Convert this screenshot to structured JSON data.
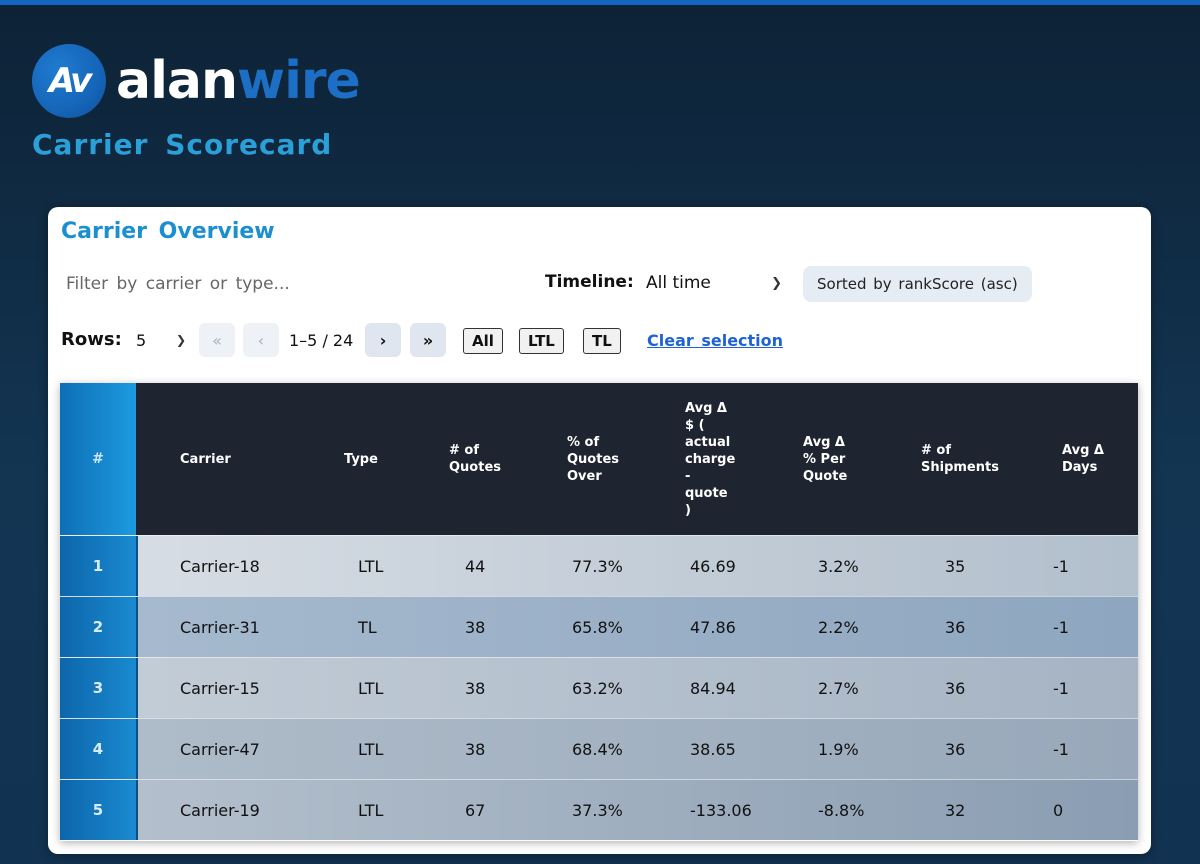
{
  "brand": {
    "logo_letters": "Av",
    "name_part1": "alan",
    "name_part2": "wire",
    "subtitle": "Carrier Scorecard"
  },
  "card": {
    "title": "Carrier Overview",
    "filter_placeholder": "Filter by carrier or type...",
    "timeline_label": "Timeline:",
    "timeline_value": "All time",
    "sort_badge": "Sorted by rankScore (asc)",
    "rows_label": "Rows:",
    "rows_value": "5",
    "pager": {
      "first": "«",
      "prev": "‹",
      "info": "1–5 / 24",
      "next": "›",
      "last": "»"
    },
    "type_filters": [
      "All",
      "LTL",
      "TL"
    ],
    "clear_selection": "Clear selection"
  },
  "table": {
    "columns": [
      "#",
      "Carrier",
      "Type",
      "# of\nQuotes",
      "% of\nQuotes\nOver",
      "Avg Δ\n$ (\nactual\ncharge\n-\nquote\n)",
      "Avg Δ\n% Per\nQuote",
      "# of\nShipments",
      "Avg Δ\nDays"
    ],
    "rows": [
      {
        "num": "1",
        "carrier": "Carrier-18",
        "type": "LTL",
        "quotes": "44",
        "pct_over": "77.3%",
        "avg_delta_usd": "46.69",
        "avg_delta_pct": "3.2%",
        "shipments": "35",
        "avg_delta_days": "-1"
      },
      {
        "num": "2",
        "carrier": "Carrier-31",
        "type": "TL",
        "quotes": "38",
        "pct_over": "65.8%",
        "avg_delta_usd": "47.86",
        "avg_delta_pct": "2.2%",
        "shipments": "36",
        "avg_delta_days": "-1"
      },
      {
        "num": "3",
        "carrier": "Carrier-15",
        "type": "LTL",
        "quotes": "38",
        "pct_over": "63.2%",
        "avg_delta_usd": "84.94",
        "avg_delta_pct": "2.7%",
        "shipments": "36",
        "avg_delta_days": "-1"
      },
      {
        "num": "4",
        "carrier": "Carrier-47",
        "type": "LTL",
        "quotes": "38",
        "pct_over": "68.4%",
        "avg_delta_usd": "38.65",
        "avg_delta_pct": "1.9%",
        "shipments": "36",
        "avg_delta_days": "-1"
      },
      {
        "num": "5",
        "carrier": "Carrier-19",
        "type": "LTL",
        "quotes": "67",
        "pct_over": "37.3%",
        "avg_delta_usd": "-133.06",
        "avg_delta_pct": "-8.8%",
        "shipments": "32",
        "avg_delta_days": "0"
      }
    ]
  },
  "colors": {
    "accent": "#1c8fd0",
    "brand_blue": "#1c6fc4",
    "header_bg": "#1e2430",
    "link": "#1e63d6"
  }
}
